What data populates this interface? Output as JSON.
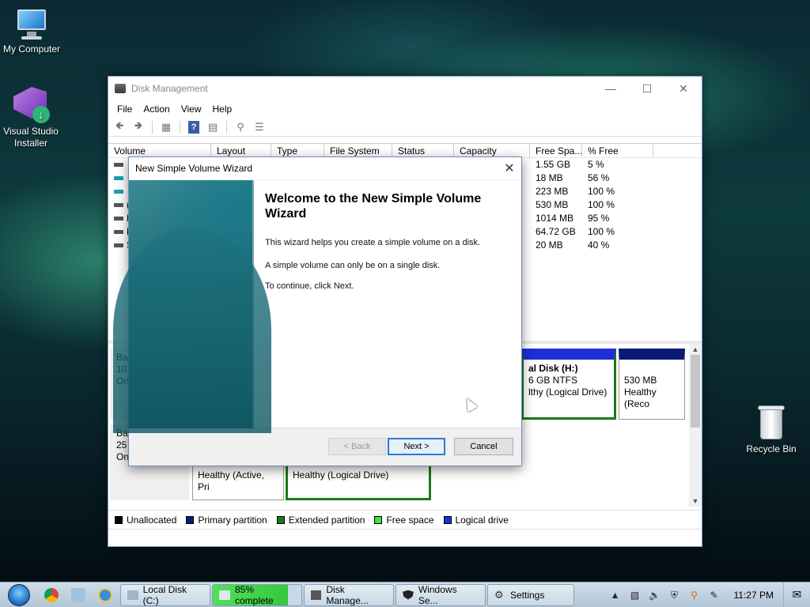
{
  "desktop": {
    "icons": [
      {
        "label": "My Computer"
      },
      {
        "label": "Visual Studio Installer"
      },
      {
        "label": "Recycle Bin"
      }
    ]
  },
  "disk_management": {
    "title": "Disk Management",
    "menu": [
      "File",
      "Action",
      "View",
      "Help"
    ],
    "columns": [
      "Volume",
      "Layout",
      "Type",
      "File System",
      "Status",
      "Capacity",
      "Free Spa...",
      "% Free"
    ],
    "rows": [
      {
        "volume_fragment": "",
        "free": "1.55 GB",
        "pct": "5 %"
      },
      {
        "volume_fragment": "",
        "free": "18 MB",
        "pct": "56 %"
      },
      {
        "volume_fragment": "",
        "free": "223 MB",
        "pct": "100 %"
      },
      {
        "volume_fragment": "(",
        "free": "530 MB",
        "pct": "100 %"
      },
      {
        "volume_fragment": "L",
        "free": "1014 MB",
        "pct": "95 %"
      },
      {
        "volume_fragment": "L",
        "free": "64.72 GB",
        "pct": "100 %"
      },
      {
        "volume_fragment": "S",
        "free": "20 MB",
        "pct": "40 %"
      }
    ],
    "disk0": {
      "label_lines": [
        "Ba",
        "10",
        "On"
      ],
      "part_h": {
        "name": "al Disk  (H:)",
        "size": "6 GB NTFS",
        "status": "lthy (Logical Drive)"
      },
      "part_rec": {
        "size": "530 MB",
        "status": "Healthy (Reco"
      }
    },
    "disk1": {
      "label_lines": [
        "Ba",
        "25",
        "Online"
      ],
      "part_a": {
        "status": "Healthy (Active, Pri"
      },
      "part_b": {
        "status": "Healthy (Logical Drive)"
      }
    },
    "legend": [
      {
        "label": "Unallocated",
        "color": "#000000"
      },
      {
        "label": "Primary partition",
        "color": "#0b1a78"
      },
      {
        "label": "Extended partition",
        "color": "#1a7a1a"
      },
      {
        "label": "Free space",
        "color": "#3ce63c"
      },
      {
        "label": "Logical drive",
        "color": "#1f2fd6"
      }
    ]
  },
  "wizard": {
    "title": "New Simple Volume Wizard",
    "heading": "Welcome to the New Simple Volume Wizard",
    "p1": "This wizard helps you create a simple volume on a disk.",
    "p2": "A simple volume can only be on a single disk.",
    "p3": "To continue, click Next.",
    "back_label": "< Back",
    "next_label": "Next >",
    "cancel_label": "Cancel"
  },
  "taskbar": {
    "tasks": [
      {
        "label": "Local Disk (C:)"
      },
      {
        "label": "85% complete",
        "progress": 0.85
      },
      {
        "label": "Disk Manage..."
      },
      {
        "label": "Windows Se..."
      },
      {
        "label": "Settings"
      }
    ],
    "clock": "11:27 PM"
  },
  "colors": {
    "accent": "#2a7ad4",
    "primary_partition": "#0b1a78",
    "logical_drive": "#1f2fd6",
    "extended_partition": "#1a7a1a"
  }
}
